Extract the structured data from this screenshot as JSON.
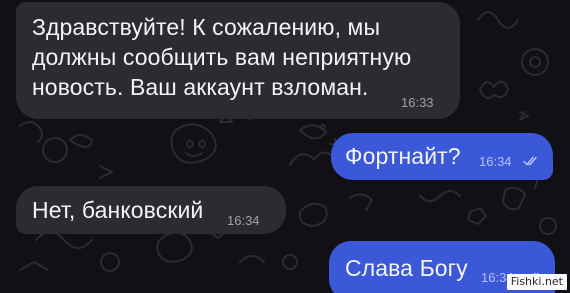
{
  "colors": {
    "background": "#111014",
    "incoming_bubble": "#2e2a31",
    "outgoing_bubble": "#3b58d8",
    "message_text": "#f3f3f6",
    "watermark_bg": "#fafafa"
  },
  "messages": [
    {
      "direction": "incoming",
      "lines": [
        "Здравствуйте! К сожалению, мы",
        "должны сообщить вам неприятную",
        "новость. Ваш аккаунт взломан."
      ],
      "time": "16:33"
    },
    {
      "direction": "outgoing",
      "lines": [
        "Фортнайт?"
      ],
      "time": "16:34",
      "status_icon": "double-check-icon"
    },
    {
      "direction": "incoming",
      "lines": [
        "Нет, банковский"
      ],
      "time": "16:34"
    },
    {
      "direction": "outgoing",
      "lines": [
        "Слава Богу"
      ],
      "time": "16:34",
      "status_icon": "double-check-icon"
    }
  ],
  "watermark": {
    "text": "Fishki.net"
  }
}
